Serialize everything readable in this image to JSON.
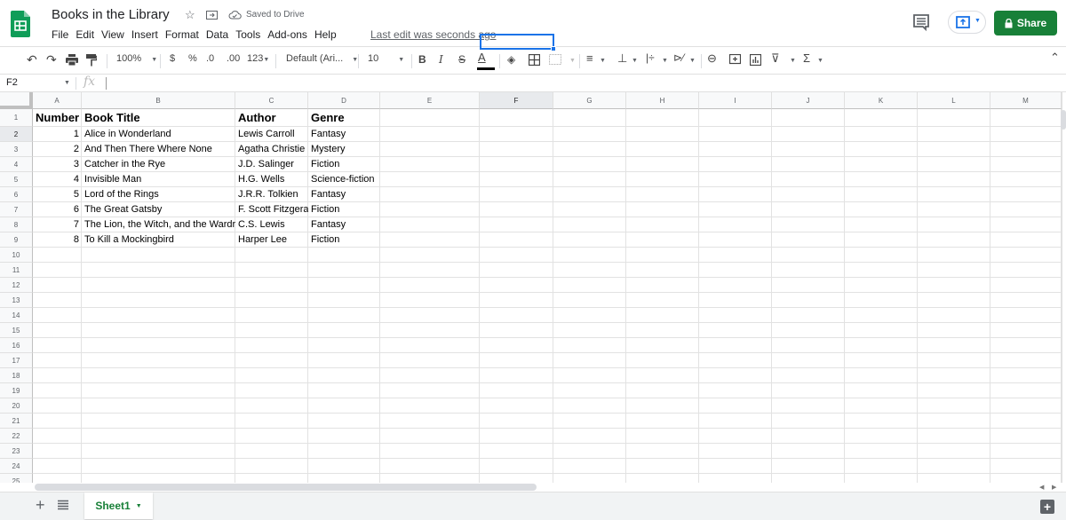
{
  "header": {
    "title": "Books in the Library",
    "saved_status": "Saved to Drive",
    "last_edit": "Last edit was seconds ago",
    "share_label": "Share",
    "menu": [
      "File",
      "Edit",
      "View",
      "Insert",
      "Format",
      "Data",
      "Tools",
      "Add-ons",
      "Help"
    ],
    "colors": {
      "share": "#188038",
      "accent": "#1a73e8",
      "sheets_green": "#0f9d58"
    }
  },
  "toolbar": {
    "zoom": "100%",
    "currency": "$",
    "percent": "%",
    "decrease_decimal": ".0",
    "increase_decimal": ".00",
    "more_formats": "123",
    "font": "Default (Ari...",
    "font_size": "10",
    "bold": "B",
    "italic": "I",
    "strikethrough": "S",
    "text_color": "A",
    "sum": "Σ"
  },
  "formula_bar": {
    "name_box": "F2",
    "fx": "fx",
    "value": ""
  },
  "grid": {
    "columns": [
      "A",
      "B",
      "C",
      "D",
      "E",
      "F",
      "G",
      "H",
      "I",
      "J",
      "K",
      "L",
      "M"
    ],
    "selected_column": "F",
    "selected_row": 2,
    "rows": [
      "1",
      "2",
      "3",
      "4",
      "5",
      "6",
      "7",
      "8",
      "9",
      "10",
      "11",
      "12",
      "13",
      "14",
      "15",
      "16",
      "17",
      "18",
      "19",
      "20",
      "21",
      "22",
      "23",
      "24",
      "25"
    ],
    "header_row": [
      "Number",
      "Book Title",
      "Author",
      "Genre"
    ],
    "data": [
      [
        "1",
        "Alice in Wonderland",
        "Lewis Carroll",
        "Fantasy"
      ],
      [
        "2",
        "And Then There Where None",
        "Agatha Christie",
        "Mystery"
      ],
      [
        "3",
        "Catcher in the Rye",
        "J.D. Salinger",
        "Fiction"
      ],
      [
        "4",
        "Invisible Man",
        "H.G. Wells",
        "Science-fiction"
      ],
      [
        "5",
        "Lord of the Rings",
        "J.R.R. Tolkien",
        "Fantasy"
      ],
      [
        "6",
        "The Great Gatsby",
        "F. Scott Fitzgera",
        "Fiction"
      ],
      [
        "7",
        "The Lion, the Witch, and the Wardr",
        "C.S. Lewis",
        "Fantasy"
      ],
      [
        "8",
        "To Kill a Mockingbird",
        "Harper Lee",
        "Fiction"
      ]
    ]
  },
  "bottom": {
    "add_sheet": "+",
    "sheet_tab": "Sheet1",
    "explore": "+"
  }
}
